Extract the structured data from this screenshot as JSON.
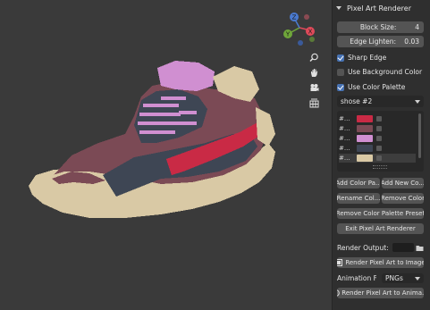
{
  "panel": {
    "title": "Pixel Art Renderer",
    "block_size": {
      "label": "Block Size:",
      "value": "4"
    },
    "edge_lighten": {
      "label": "Edge Lighten:",
      "value": "0.03"
    },
    "sharp_edge": {
      "label": "Sharp Edge",
      "checked": true
    },
    "use_background_color": {
      "label": "Use Background Color",
      "checked": false
    },
    "use_color_palette": {
      "label": "Use Color Palette",
      "checked": true
    },
    "palette_preset": "shose #2",
    "palette_items": [
      {
        "name": "#...",
        "color": "#c92a45"
      },
      {
        "name": "#...",
        "color": "#7b4a55"
      },
      {
        "name": "#...",
        "color": "#d08fd1"
      },
      {
        "name": "#...",
        "color": "#3e4654"
      },
      {
        "name": "#...",
        "color": "#d9c9a5"
      }
    ],
    "buttons": {
      "add_color_palette": "Add Color Pa...",
      "add_new_color": "Add New Co...",
      "rename_color": "Rename Col...",
      "remove_color": "Remove Color",
      "remove_preset": "Remove Color Palette Preset",
      "exit": "Exit Pixel Art Renderer",
      "render_image": "Render Pixel Art to Image",
      "render_animation": "Render Pixel Art to Anima..."
    },
    "render_output_label": "Render Output:",
    "animation_format_label": "Animation Fo...",
    "animation_format_value": "PNGs"
  },
  "viewport_icons": [
    "zoom-icon",
    "hand-icon",
    "camera-icon",
    "grid-icon"
  ],
  "gizmo": {
    "x_label": "X",
    "y_label": "Y",
    "z_label": "Z"
  }
}
